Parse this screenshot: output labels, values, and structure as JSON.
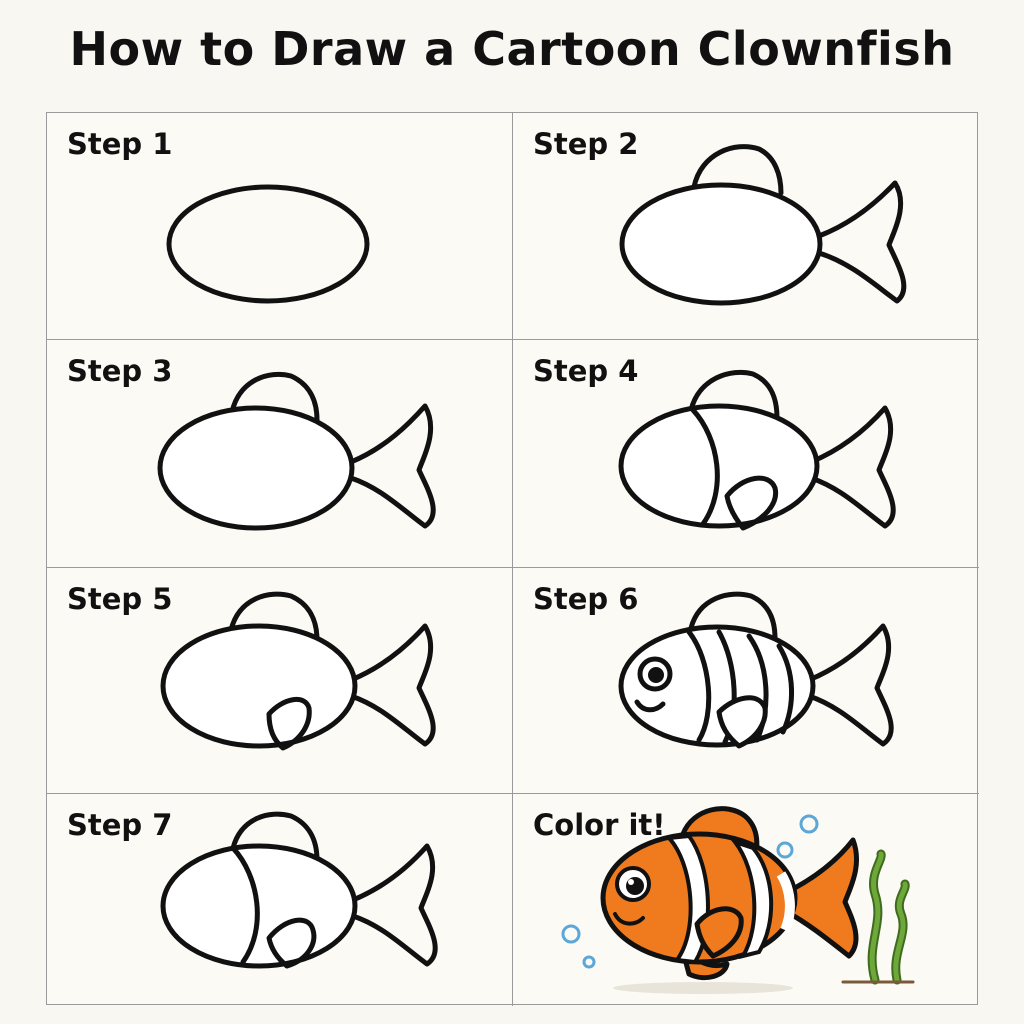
{
  "title": "How to Draw a Cartoon Clownfish",
  "steps": [
    {
      "label": "Step 1"
    },
    {
      "label": "Step 2"
    },
    {
      "label": "Step 3"
    },
    {
      "label": "Step 4"
    },
    {
      "label": "Step 5"
    },
    {
      "label": "Step 6"
    },
    {
      "label": "Step 7"
    },
    {
      "label": "Color it!"
    }
  ],
  "colors": {
    "outline": "#111111",
    "fish_orange": "#f07b1e",
    "stripe_white": "#ffffff",
    "bubble_blue": "#5aa7d8",
    "seaweed_green": "#6ea83a"
  }
}
